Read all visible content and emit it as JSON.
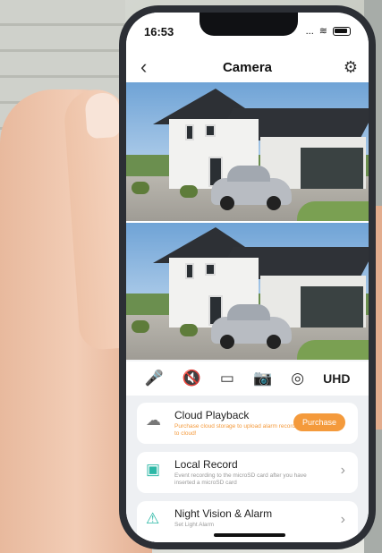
{
  "status": {
    "time": "16:53",
    "signal": "...",
    "wifi": "wifi-icon"
  },
  "header": {
    "title": "Camera",
    "back": "‹",
    "settings": "gear-icon"
  },
  "controls": {
    "items": [
      {
        "name": "microphone-icon",
        "glyph": "🎤"
      },
      {
        "name": "mute-icon",
        "glyph": "🔇"
      },
      {
        "name": "record-video-icon",
        "glyph": "▭"
      },
      {
        "name": "snapshot-icon",
        "glyph": "📷"
      },
      {
        "name": "ptz-icon",
        "glyph": "◎"
      }
    ],
    "quality": "UHD"
  },
  "cards": {
    "cloud": {
      "title": "Cloud Playback",
      "subtitle": "Purchase cloud storage to upload alarm recordings to cloud!",
      "button": "Purchase",
      "accent": "#f49a3c"
    },
    "local": {
      "title": "Local Record",
      "subtitle": "Event recording to the microSD card after you have inserted a microSD card",
      "chevron": "›"
    },
    "night": {
      "title": "Night Vision & Alarm",
      "subtitle": "Set Light Alarm",
      "chevron": "›"
    }
  }
}
